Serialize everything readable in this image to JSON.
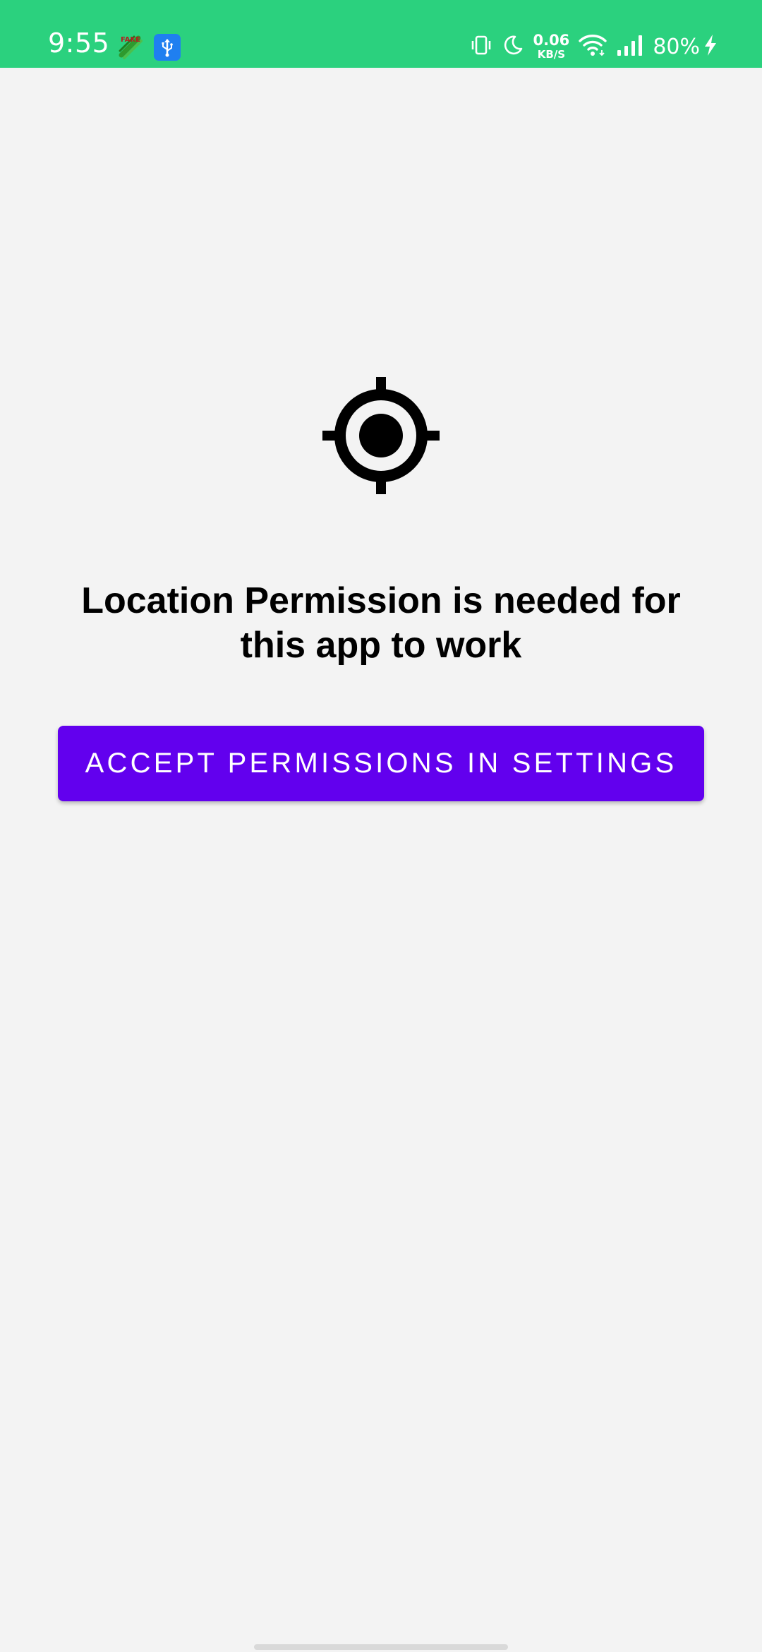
{
  "status_bar": {
    "time": "9:55",
    "fake_badge": "FAKE",
    "network_speed_value": "0.06",
    "network_speed_unit": "KB/S",
    "battery_percent": "80%",
    "background_color": "#2bd17e",
    "icons": [
      "fake-gps-icon",
      "usb-debug-icon",
      "vibrate-icon",
      "moon-icon",
      "wifi-icon",
      "cell-signal-icon",
      "charging-bolt-icon"
    ]
  },
  "main": {
    "icon": "gps-target-icon",
    "message": "Location Permission is needed for this app to work",
    "button_label": "ACCEPT PERMISSIONS IN SETTINGS",
    "button_color": "#6200ee",
    "background_color": "#f3f3f3"
  }
}
